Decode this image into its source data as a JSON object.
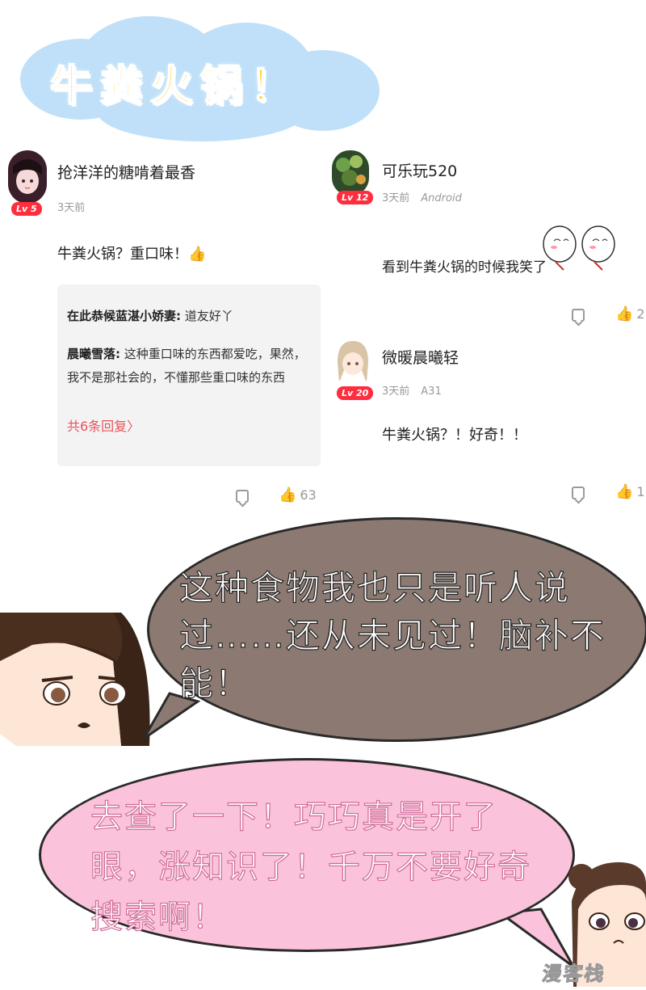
{
  "title": "牛粪火锅！",
  "comments": [
    {
      "username": "抢洋洋的糖啃着最香",
      "level": "Lv 5",
      "time": "3天前",
      "text": "牛粪火锅？重口味！👍",
      "replies": [
        {
          "name": "在此恭候蓝湛小娇妻:",
          "text": " 道友好丫"
        },
        {
          "name": "晨曦雪落:",
          "text": " 这种重口味的东西都爱吃，果然，我不是那社会的，不懂那些重口味的东西"
        }
      ],
      "more_replies": "共6条回复〉",
      "likes": "63"
    },
    {
      "username": "可乐玩520",
      "level": "Lv 12",
      "time": "3天前",
      "device": "Android",
      "text": "看到牛粪火锅的时候我笑了",
      "likes": "2"
    },
    {
      "username": "微暖晨曦轻",
      "level": "Lv 20",
      "time": "3天前",
      "device": "A31",
      "text": "牛粪火锅？！好奇！！",
      "likes": "1"
    }
  ],
  "bubble_dark": "这种食物我也只是听人说过……还从未见过！脑补不能！",
  "bubble_pink": "去查了一下！巧巧真是开了眼，涨知识了！千万不要好奇搜索啊！",
  "watermark": "漫客栈",
  "colors": {
    "level_badge": "#ff2e3e",
    "title": "#ffd21a",
    "cloud": "#bfe0f8",
    "dark_bubble": "#8c7a72",
    "pink_bubble": "#fbc2db"
  }
}
